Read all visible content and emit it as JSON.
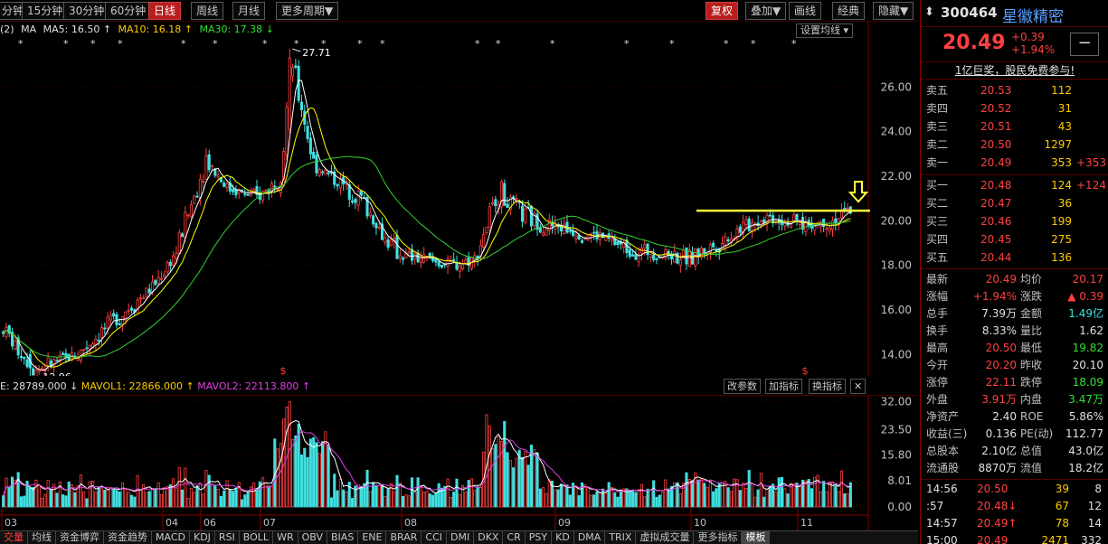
{
  "toolbar": {
    "periods": [
      "15分钟",
      "30分钟",
      "60分钟",
      "日线",
      "周线",
      "月线",
      "更多周期▼"
    ],
    "first_clip": "分钟",
    "active_period": "日线",
    "right_buttons": [
      "复权",
      "叠加▼",
      "画线",
      "经典",
      "隐藏▼"
    ]
  },
  "ma_legend": {
    "prefix": "(2)",
    "ma": "MA",
    "ma5": "MA5: 16.50 ↑",
    "ma10": "MA10: 16.18 ↑",
    "ma30": "MA30: 17.38 ↓",
    "set_btn": "设置均线 ▾"
  },
  "annotations": {
    "high_label": "27.71",
    "low_label": "12.96",
    "dollar": "$"
  },
  "vol_legend": {
    "vol": "E: 28789.000 ↓",
    "mavol1": "MAVOL1: 22866.000 ↑",
    "mavol2": "MAVOL2: 22113.800 ↑",
    "btn_params": "改参数",
    "btn_add": "加指标",
    "btn_switch": "换指标",
    "btn_close": "✕"
  },
  "x_labels": [
    "03",
    "04",
    "06",
    "07",
    "08",
    "09",
    "10",
    "11"
  ],
  "bottom_tabs": [
    "交量",
    "均线",
    "资金博弈",
    "资金趋势",
    "MACD",
    "KDJ",
    "RSI",
    "BOLL",
    "WR",
    "OBV",
    "BIAS",
    "ENE",
    "BRAR",
    "CCI",
    "DMI",
    "DKX",
    "CR",
    "PSY",
    "KD",
    "DMA",
    "TRIX",
    "虚拟成交量",
    "更多指标",
    "模板"
  ],
  "chart_data": {
    "type": "candlestick",
    "price_ticks": [
      26.0,
      24.0,
      22.0,
      20.0,
      18.0,
      16.0,
      14.0
    ],
    "price_range": [
      13.2,
      28.2
    ],
    "volume_ticks": [
      32.0,
      23.5,
      15.8,
      8.01,
      0.0
    ],
    "volume_range": [
      0,
      33.5
    ],
    "resistance_level": 20.45,
    "colors": {
      "up": "#ff4040",
      "down": "#40e0e0",
      "ma5": "#ffffff",
      "ma10": "#ffff00",
      "ma30": "#30d030",
      "mavol2": "#e040e0",
      "resistance": "#ffff40"
    }
  },
  "quote": {
    "code": "300464",
    "name": "星徽精密",
    "price": "20.49",
    "change": "+0.39",
    "change_pct": "+1.94%",
    "minus": "−",
    "ad": "1亿巨奖，股民免费参与!",
    "asks": [
      {
        "label": "卖五",
        "price": "20.53",
        "vol": "112",
        "delta": ""
      },
      {
        "label": "卖四",
        "price": "20.52",
        "vol": "31",
        "delta": ""
      },
      {
        "label": "卖三",
        "price": "20.51",
        "vol": "43",
        "delta": ""
      },
      {
        "label": "卖二",
        "price": "20.50",
        "vol": "1297",
        "delta": ""
      },
      {
        "label": "卖一",
        "price": "20.49",
        "vol": "353",
        "delta": "+353"
      }
    ],
    "bids": [
      {
        "label": "买一",
        "price": "20.48",
        "vol": "124",
        "delta": "+124"
      },
      {
        "label": "买二",
        "price": "20.47",
        "vol": "36",
        "delta": ""
      },
      {
        "label": "买三",
        "price": "20.46",
        "vol": "199",
        "delta": ""
      },
      {
        "label": "买四",
        "price": "20.45",
        "vol": "275",
        "delta": ""
      },
      {
        "label": "买五",
        "price": "20.44",
        "vol": "136",
        "delta": ""
      }
    ],
    "stats": [
      {
        "k1": "最新",
        "v1": "20.49",
        "c1": "red",
        "k2": "均价",
        "v2": "20.17",
        "c2": "red"
      },
      {
        "k1": "涨幅",
        "v1": "+1.94%",
        "c1": "red",
        "k2": "涨跌",
        "v2": "▲ 0.39",
        "c2": "red"
      },
      {
        "k1": "总手",
        "v1": "7.39万",
        "c1": "white",
        "k2": "金额",
        "v2": "1.49亿",
        "c2": "cyan"
      },
      {
        "k1": "换手",
        "v1": "8.33%",
        "c1": "white",
        "k2": "量比",
        "v2": "1.62",
        "c2": "white"
      },
      {
        "k1": "最高",
        "v1": "20.50",
        "c1": "red",
        "k2": "最低",
        "v2": "19.82",
        "c2": "green"
      },
      {
        "k1": "今开",
        "v1": "20.20",
        "c1": "red",
        "k2": "昨收",
        "v2": "20.10",
        "c2": "white"
      },
      {
        "k1": "涨停",
        "v1": "22.11",
        "c1": "red",
        "k2": "跌停",
        "v2": "18.09",
        "c2": "green"
      },
      {
        "k1": "外盘",
        "v1": "3.91万",
        "c1": "red",
        "k2": "内盘",
        "v2": "3.47万",
        "c2": "green"
      },
      {
        "k1": "净资产",
        "v1": "2.40",
        "c1": "white",
        "k2": "ROE",
        "v2": "5.86%",
        "c2": "white"
      },
      {
        "k1": "收益(三)",
        "v1": "0.136",
        "c1": "white",
        "k2": "PE(动)",
        "v2": "112.77",
        "c2": "white"
      },
      {
        "k1": "总股本",
        "v1": "2.10亿",
        "c1": "white",
        "k2": "总值",
        "v2": "43.0亿",
        "c2": "white"
      },
      {
        "k1": "流通股",
        "v1": "8870万",
        "c1": "white",
        "k2": "流值",
        "v2": "18.2亿",
        "c2": "white"
      }
    ],
    "ticks": [
      {
        "time": "14:56",
        "price": "20.50",
        "arrow": "",
        "vol": "39",
        "num": "8"
      },
      {
        "time": ":57",
        "price": "20.48↓",
        "arrow": "down",
        "vol": "67",
        "num": "12"
      },
      {
        "time": "14:57",
        "price": "20.49↑",
        "arrow": "up",
        "vol": "78",
        "num": "14"
      },
      {
        "time": "15:00",
        "price": "20.49",
        "arrow": "",
        "vol": "2471",
        "num": "332"
      }
    ]
  }
}
